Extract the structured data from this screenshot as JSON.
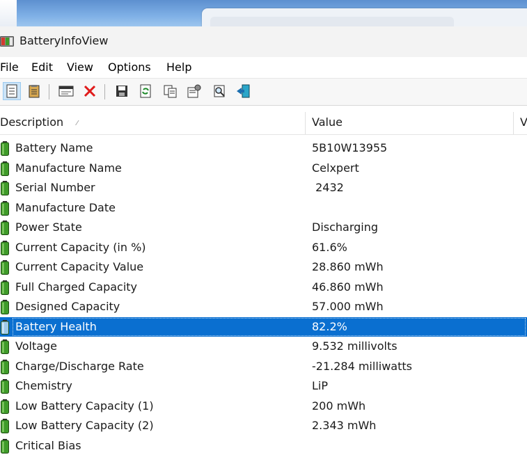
{
  "window": {
    "title": "BatteryInfoView"
  },
  "menu": [
    "File",
    "Edit",
    "View",
    "Options",
    "Help"
  ],
  "toolbar": {
    "buttons": [
      {
        "icon": "html-report-icon"
      },
      {
        "icon": "clipboard-icon"
      },
      {
        "icon": "properties-window-icon"
      },
      {
        "icon": "delete-icon"
      },
      {
        "icon": "save-icon"
      },
      {
        "icon": "refresh-icon"
      },
      {
        "icon": "copy-icon"
      },
      {
        "icon": "properties-icon"
      },
      {
        "icon": "find-icon"
      },
      {
        "icon": "exit-icon"
      }
    ]
  },
  "columns": {
    "description": "Description",
    "value": "Value",
    "extra": "V"
  },
  "rows": [
    {
      "description": "Battery Name",
      "value": "5B10W13955"
    },
    {
      "description": "Manufacture Name",
      "value": "Celxpert"
    },
    {
      "description": "Serial Number",
      "value": " 2432"
    },
    {
      "description": "Manufacture Date",
      "value": ""
    },
    {
      "description": "Power State",
      "value": "Discharging"
    },
    {
      "description": "Current Capacity (in %)",
      "value": "61.6%"
    },
    {
      "description": "Current Capacity Value",
      "value": "28.860 mWh"
    },
    {
      "description": "Full Charged Capacity",
      "value": "46.860 mWh"
    },
    {
      "description": "Designed Capacity",
      "value": "57.000 mWh"
    },
    {
      "description": "Battery Health",
      "value": "82.2%",
      "selected": true
    },
    {
      "description": "Voltage",
      "value": "9.532 millivolts"
    },
    {
      "description": "Charge/Discharge Rate",
      "value": "-21.284 milliwatts"
    },
    {
      "description": "Chemistry",
      "value": "LiP"
    },
    {
      "description": "Low Battery Capacity (1)",
      "value": "200 mWh"
    },
    {
      "description": "Low Battery Capacity (2)",
      "value": "2.343 mWh"
    },
    {
      "description": "Critical Bias",
      "value": ""
    }
  ],
  "colors": {
    "selection": "#0a6fd0",
    "battery_green": "#3f9b2a"
  }
}
